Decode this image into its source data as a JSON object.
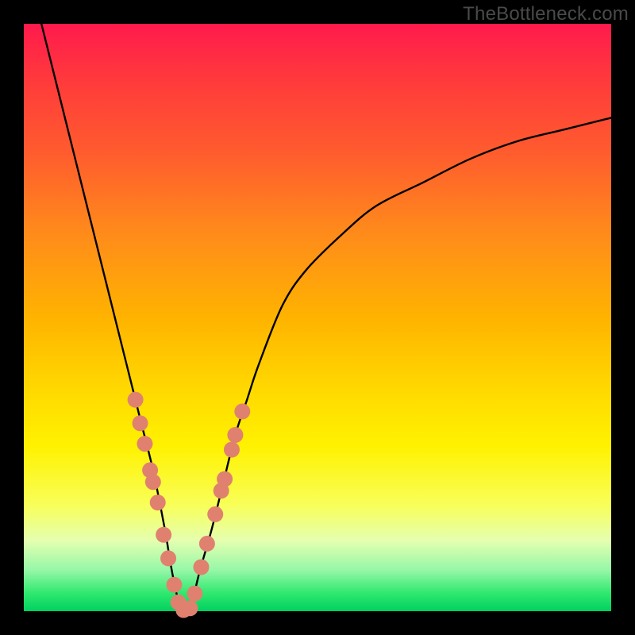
{
  "watermark": "TheBottleneck.com",
  "chart_data": {
    "type": "line",
    "title": "",
    "xlabel": "",
    "ylabel": "",
    "xlim": [
      0,
      100
    ],
    "ylim": [
      0,
      100
    ],
    "grid": false,
    "legend": false,
    "series": [
      {
        "name": "bottleneck-curve",
        "color": "#000000",
        "x": [
          3,
          5,
          7,
          10,
          13,
          16,
          18,
          20,
          22,
          24,
          25,
          26,
          27,
          28,
          29,
          30,
          32,
          34,
          36,
          38,
          40,
          44,
          48,
          54,
          60,
          68,
          76,
          84,
          92,
          100
        ],
        "y": [
          100,
          92,
          84,
          72,
          60,
          48,
          40,
          32,
          24,
          14,
          8,
          3,
          0,
          0,
          3,
          7,
          14,
          22,
          30,
          36,
          42,
          52,
          58,
          64,
          69,
          73,
          77,
          80,
          82,
          84
        ]
      }
    ],
    "markers": {
      "name": "highlight-points",
      "color": "#e0816f",
      "radius": 10,
      "points": [
        {
          "x": 19.0,
          "y": 36.0
        },
        {
          "x": 19.8,
          "y": 32.0
        },
        {
          "x": 20.6,
          "y": 28.5
        },
        {
          "x": 21.5,
          "y": 24.0
        },
        {
          "x": 22.0,
          "y": 22.0
        },
        {
          "x": 22.8,
          "y": 18.5
        },
        {
          "x": 23.8,
          "y": 13.0
        },
        {
          "x": 24.6,
          "y": 9.0
        },
        {
          "x": 25.6,
          "y": 4.5
        },
        {
          "x": 26.3,
          "y": 1.5
        },
        {
          "x": 27.2,
          "y": 0.2
        },
        {
          "x": 28.3,
          "y": 0.5
        },
        {
          "x": 29.1,
          "y": 3.0
        },
        {
          "x": 30.2,
          "y": 7.5
        },
        {
          "x": 31.2,
          "y": 11.5
        },
        {
          "x": 32.6,
          "y": 16.5
        },
        {
          "x": 33.6,
          "y": 20.5
        },
        {
          "x": 34.2,
          "y": 22.5
        },
        {
          "x": 35.4,
          "y": 27.5
        },
        {
          "x": 36.0,
          "y": 30.0
        },
        {
          "x": 37.2,
          "y": 34.0
        }
      ]
    }
  }
}
